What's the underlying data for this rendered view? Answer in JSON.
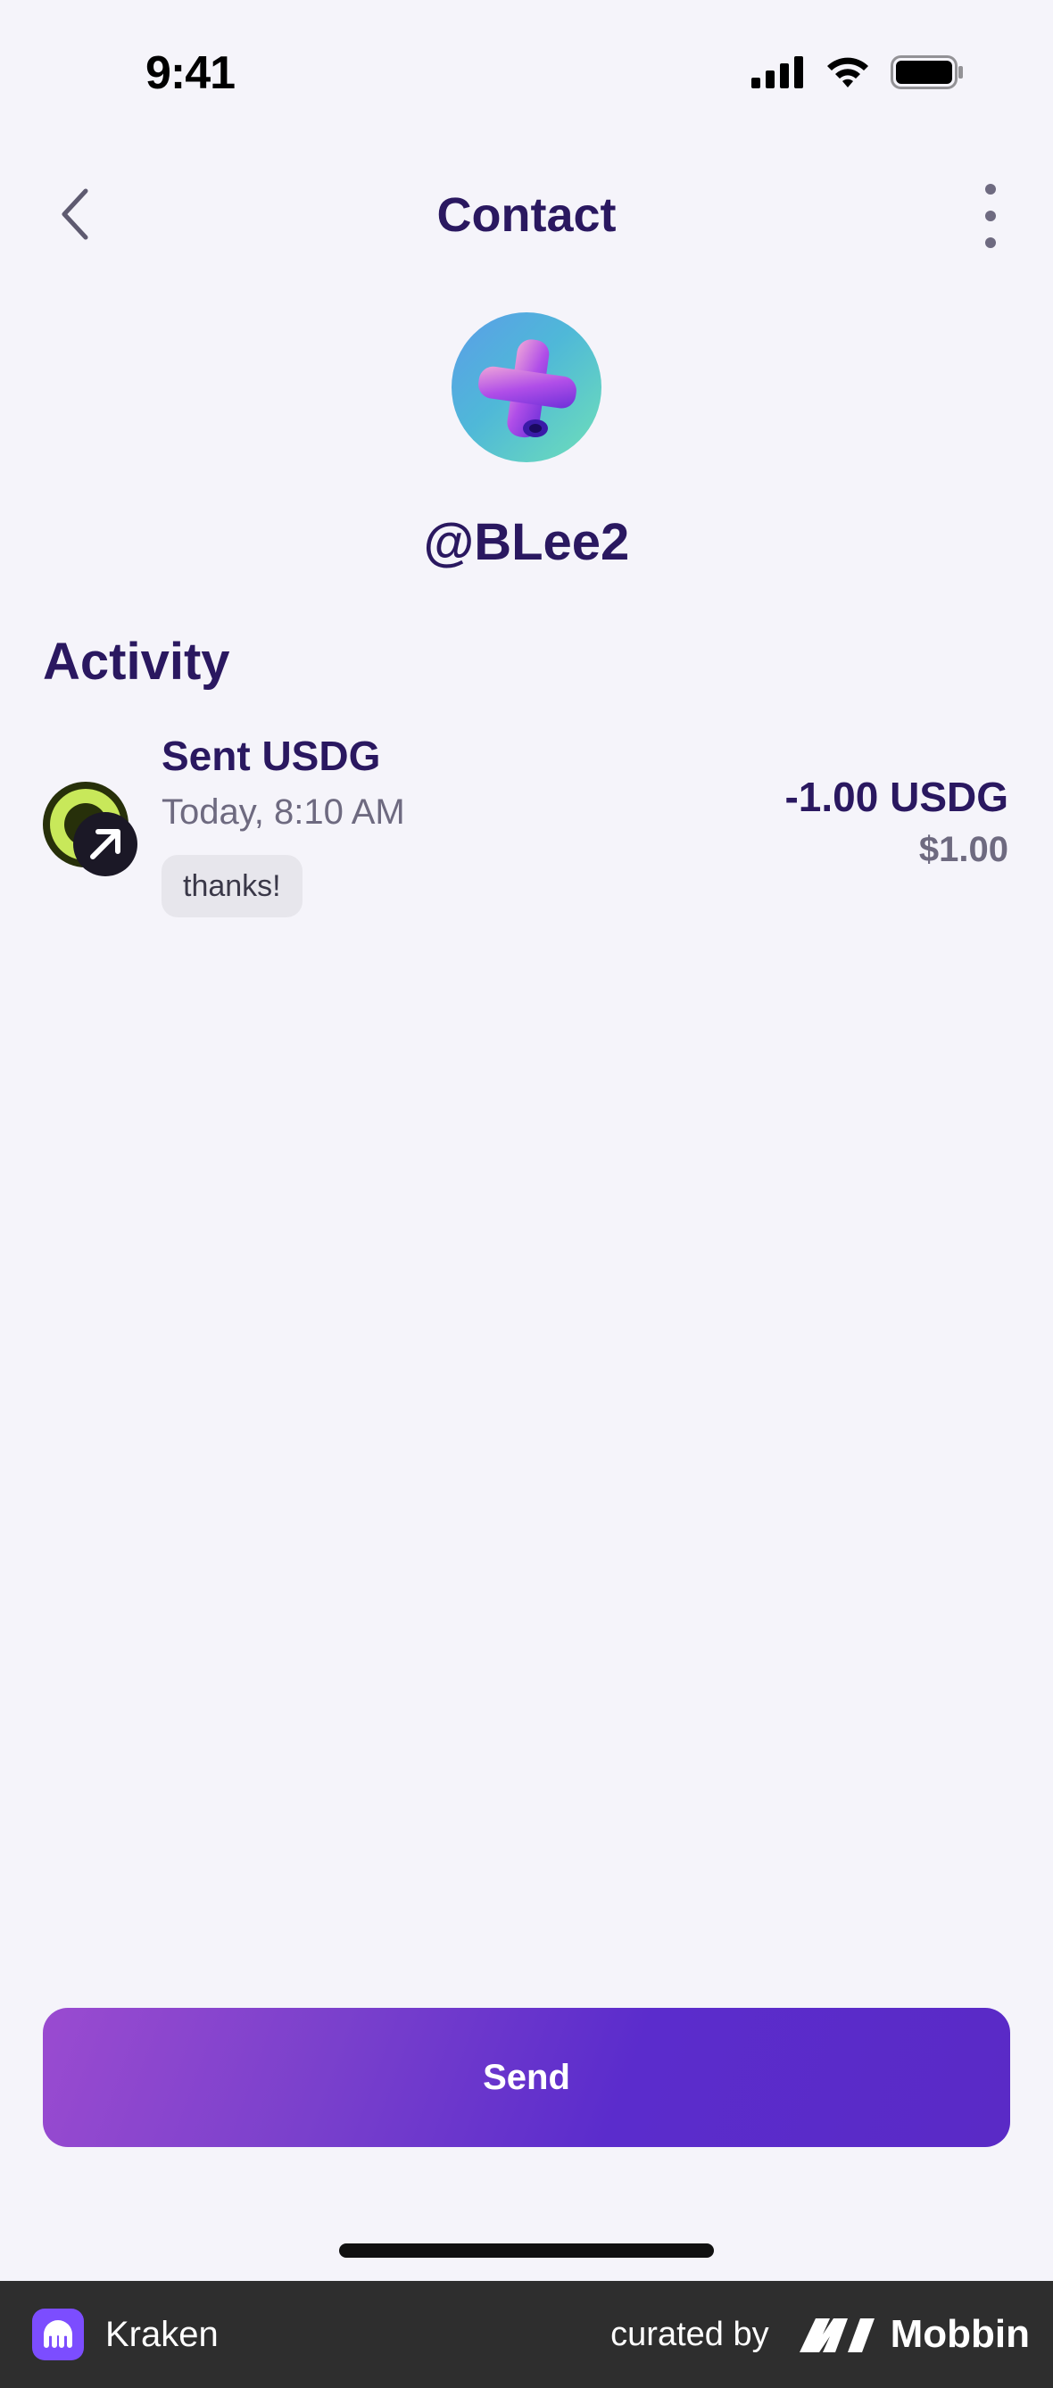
{
  "status_bar": {
    "time": "9:41"
  },
  "header": {
    "title": "Contact"
  },
  "contact": {
    "username": "@BLee2"
  },
  "activity": {
    "title": "Activity",
    "items": [
      {
        "title": "Sent USDG",
        "time": "Today, 8:10 AM",
        "note": "thanks!",
        "amount": "-1.00 USDG",
        "fiat": "$1.00"
      }
    ]
  },
  "actions": {
    "send_label": "Send"
  },
  "footer": {
    "app_name": "Kraken",
    "curated_by": "curated by",
    "brand": "Mobbin"
  },
  "colors": {
    "primary_text": "#2a1860",
    "secondary_text": "#6e6a80",
    "background": "#f5f4fa",
    "button_gradient_start": "#9a4bd0",
    "button_gradient_end": "#5a2ac6",
    "footer_bg": "#2e2e2e"
  },
  "icons": [
    "chevron-left-icon",
    "more-vertical-icon",
    "signal-icon",
    "wifi-icon",
    "battery-icon",
    "sent-arrow-icon",
    "kraken-logo",
    "mobbin-logo"
  ]
}
